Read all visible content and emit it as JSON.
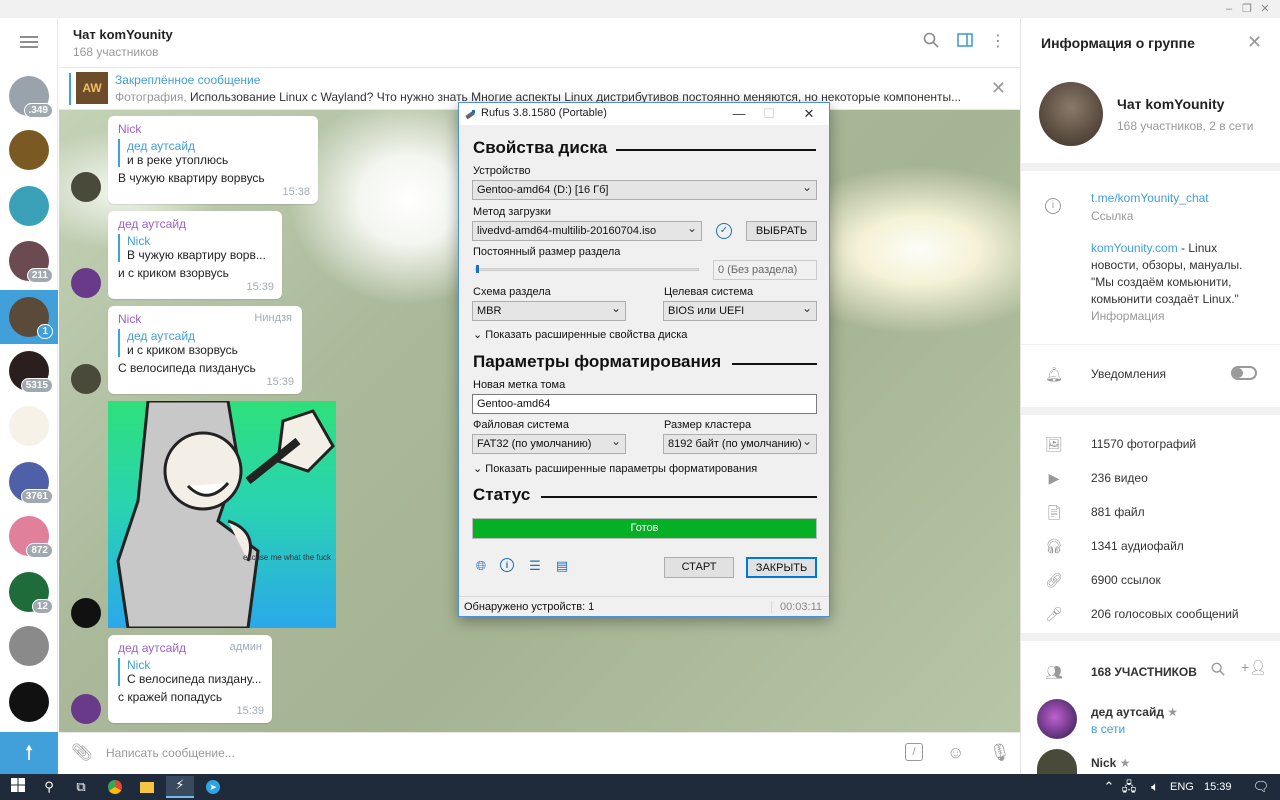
{
  "chat": {
    "title": "Чат komYounity",
    "subtitle": "168 участников"
  },
  "pinned": {
    "title": "Закреплённое сообщение",
    "prefix": "Фотография, ",
    "text": "Использование Linux с Wayland? Что нужно знать  Многие аспекты Linux дистрибутивов постоянно меняются, но некоторые компоненты..."
  },
  "sidebar_chats": [
    {
      "badge": ".349",
      "color": "#9aa3ab"
    },
    {
      "badge": "",
      "color": "#7a5a22"
    },
    {
      "badge": "",
      "color": "#3aa0b8"
    },
    {
      "badge": "211",
      "color": "#6b4a52"
    },
    {
      "badge": "1",
      "color": "#5a4a3a"
    },
    {
      "badge": "5315",
      "color": "#2a1e1e"
    },
    {
      "badge": "",
      "color": "#f7f2e8"
    },
    {
      "badge": "3761",
      "color": "#5060a8"
    },
    {
      "badge": "872",
      "color": "#e0809a"
    },
    {
      "badge": "12",
      "color": "#1f6b3a"
    },
    {
      "badge": "",
      "color": "#8a8a8a"
    },
    {
      "badge": "",
      "color": "#111111"
    }
  ],
  "messages": [
    {
      "author": "Nick",
      "reply_author": "дед аутсайд",
      "reply_text": "и в реке утоплюсь",
      "text": "В чужую квартиру ворвусь",
      "time": "15:38",
      "role": ""
    },
    {
      "author": "дед аутсайд",
      "reply_author": "Nick",
      "reply_text": "В чужую квартиру ворв...",
      "text": "и с криком взорвусь",
      "time": "15:39",
      "role": ""
    },
    {
      "author": "Nick",
      "reply_author": "дед аутсайд",
      "reply_text": "и с криком взорвусь",
      "text": "С велосипеда пизданусь",
      "time": "15:39",
      "role": "Ниндзя"
    },
    {
      "author": "дед аутсайд",
      "reply_author": "Nick",
      "reply_text": "С велосипеда пиздану...",
      "text": "с кражей попадусь",
      "time": "15:39",
      "role": "админ"
    }
  ],
  "image_caption": "excuse me what the fuck",
  "composer": {
    "placeholder": "Написать сообщение..."
  },
  "rightpanel": {
    "header": "Информация о группе",
    "group_name": "Чат komYounity",
    "group_sub": "168 участников, 2 в сети",
    "link": "t.me/komYounity_chat",
    "link_label": "Ссылка",
    "desc_link": "komYounity.com",
    "desc": " - Linux новости, обзоры, мануалы. \"Мы создаём комьюнити, комьюнити создаёт Linux.\"",
    "info_label": "Информация",
    "notifications": "Уведомления",
    "media": [
      {
        "icon": "photo-icon",
        "label": "11570 фотографий"
      },
      {
        "icon": "video-icon",
        "label": "236 видео"
      },
      {
        "icon": "file-icon",
        "label": "881 файл"
      },
      {
        "icon": "audio-icon",
        "label": "1341 аудиофайл"
      },
      {
        "icon": "link-icon",
        "label": "6900 ссылок"
      },
      {
        "icon": "voice-icon",
        "label": "206 голосовых сообщений"
      }
    ],
    "members_header": "168 УЧАСТНИКОВ",
    "members": [
      {
        "name": "дед аутсайд",
        "status": "в сети"
      },
      {
        "name": "Nick",
        "status": ""
      }
    ]
  },
  "rufus": {
    "title": "Rufus 3.8.1580 (Portable)",
    "section_disk": "Свойства диска",
    "device_label": "Устройство",
    "device_value": "Gentoo-amd64 (D:) [16 Гб]",
    "boot_label": "Метод загрузки",
    "boot_value": "livedvd-amd64-multilib-20160704.iso",
    "select_btn": "ВЫБРАТЬ",
    "persistent_label": "Постоянный размер раздела",
    "persistent_value": "0 (Без раздела)",
    "scheme_label": "Схема раздела",
    "scheme_value": "MBR",
    "target_label": "Целевая система",
    "target_value": "BIOS или UEFI",
    "adv_disk": "Показать расширенные свойства диска",
    "section_format": "Параметры форматирования",
    "volume_label": "Новая метка тома",
    "volume_value": "Gentoo-amd64",
    "fs_label": "Файловая система",
    "fs_value": "FAT32 (по умолчанию)",
    "cluster_label": "Размер кластера",
    "cluster_value": "8192 байт (по умолчанию)",
    "adv_format": "Показать расширенные параметры форматирования",
    "section_status": "Статус",
    "status_text": "Готов",
    "progress": 1.0,
    "start_btn": "СТАРТ",
    "close_btn": "ЗАКРЫТЬ",
    "footer_status": "Обнаружено устройств: 1",
    "footer_time": "00:03:11"
  },
  "taskbar": {
    "lang": "ENG",
    "time": "15:39"
  },
  "colors": {
    "accent": "#419fd9",
    "progress_green": "#06b025",
    "author_purple": "#9c61c9",
    "taskbar": "#1f2b3b"
  }
}
